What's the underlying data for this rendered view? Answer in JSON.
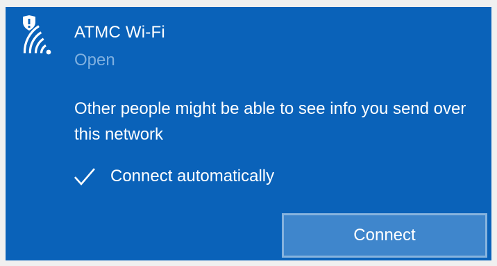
{
  "network": {
    "name": "ATMC Wi-Fi",
    "status": "Open",
    "icon": "wifi-unsecured-icon"
  },
  "warning_text": "Other people might be able to see info you send over this network",
  "auto_connect": {
    "label": "Connect automatically",
    "checked": true
  },
  "connect_button": {
    "label": "Connect"
  },
  "colors": {
    "panel_background": "#0a62b9",
    "status_text": "#7fb0e0",
    "button_background": "#3f86cc",
    "button_border": "#86b3de",
    "text": "#ffffff"
  }
}
